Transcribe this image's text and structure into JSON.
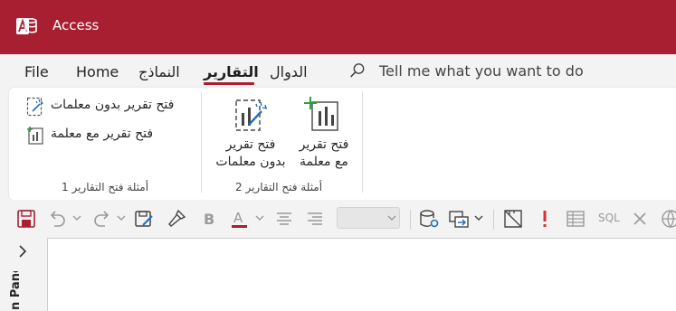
{
  "app": {
    "name": "Access"
  },
  "menu": {
    "file": "File",
    "home": "Home",
    "forms": "النماذج",
    "reports": "التقارير",
    "functions": "الدوال",
    "active_tab": "التقارير"
  },
  "search": {
    "placeholder": "Tell me what you want to do"
  },
  "ribbon": {
    "group1": {
      "label": "أمثلة فتح التقارير 1",
      "btn_open_no_params": "فتح تقرير بدون معلمات",
      "btn_open_with_param": "فتح تقرير مع معلمة"
    },
    "group2": {
      "label": "أمثلة فتح التقارير 2",
      "btn_open_no_params_line1": "فتح تقرير",
      "btn_open_no_params_line2": "بدون معلمات",
      "btn_open_with_param_line1": "فتح تقرير",
      "btn_open_with_param_line2": "مع معلمة"
    }
  },
  "qat": {
    "sql_label": "SQL"
  },
  "nav_pane": {
    "label": "n Pane"
  },
  "colors": {
    "accent": "#a91f32",
    "ribbon_bg": "#ffffff",
    "app_bg": "#f3f3f3",
    "disabled": "#9a9a9a"
  }
}
